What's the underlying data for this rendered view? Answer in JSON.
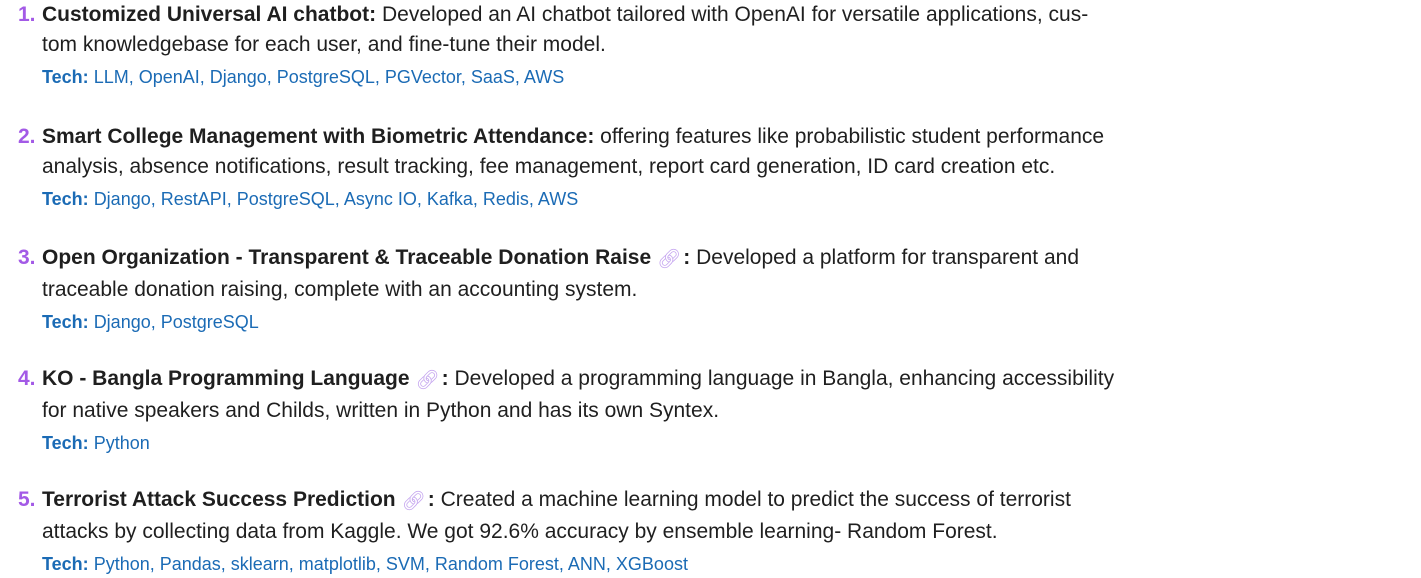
{
  "projects": [
    {
      "number": "1.",
      "title": "Customized Universal AI chatbot",
      "has_link": false,
      "line1": "Developed an AI chatbot tailored with OpenAI for versatile applications, cus-",
      "line2": "tom knowledgebase for each user, and fine-tune their model.",
      "tech_label": "Tech:",
      "tech": "LLM, OpenAI, Django, PostgreSQL, PGVector, SaaS, AWS"
    },
    {
      "number": "2.",
      "title": "Smart College Management with Biometric Attendance",
      "has_link": false,
      "line1": "offering features like probabilistic student performance",
      "line2": "analysis, absence notifications, result tracking, fee management, report card generation, ID card creation etc.",
      "tech_label": "Tech:",
      "tech": "Django, RestAPI, PostgreSQL, Async IO, Kafka, Redis, AWS"
    },
    {
      "number": "3.",
      "title": "Open Organization - Transparent & Traceable Donation Raise",
      "has_link": true,
      "line1": "Developed a platform for transparent and",
      "line2": "traceable donation raising, complete with an accounting system.",
      "tech_label": "Tech:",
      "tech": "Django, PostgreSQL"
    },
    {
      "number": "4.",
      "title": "KO - Bangla Programming Language",
      "has_link": true,
      "line1": "Developed a programming language in Bangla, enhancing accessibility",
      "line2": "for native speakers and Childs, written in Python and has its own Syntex.",
      "tech_label": "Tech:",
      "tech": "Python"
    },
    {
      "number": "5.",
      "title": "Terrorist Attack Success Prediction",
      "has_link": true,
      "line1": "Created a machine learning model to predict the success of terrorist",
      "line2": "attacks by collecting data from Kaggle. We got 92.6% accuracy by ensemble learning- Random Forest.",
      "tech_label": "Tech:",
      "tech": "Python, Pandas, sklearn, matplotlib, SVM, Random Forest, ANN, XGBoost"
    }
  ],
  "link_icon": "link-icon",
  "colors": {
    "number": "#a35ae6",
    "tech": "#1b6bb5",
    "link_icon": "#c4a4ef",
    "text": "#1f1f1f"
  }
}
